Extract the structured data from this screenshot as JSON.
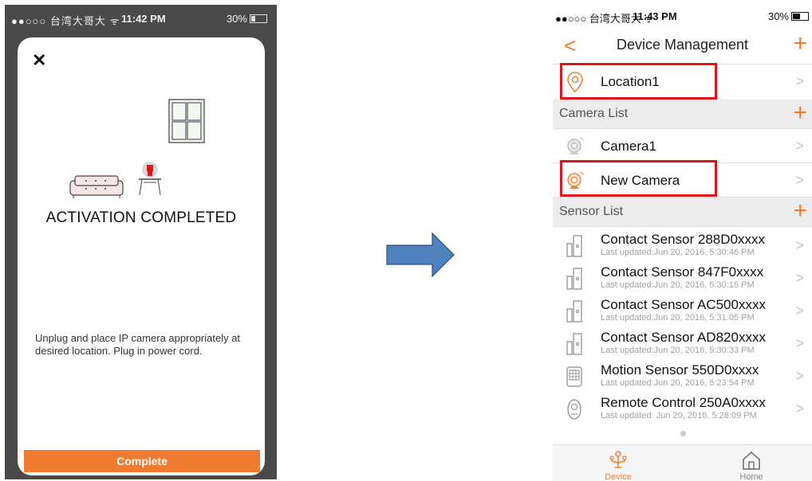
{
  "left_phone": {
    "status": {
      "signal": "●●○○○ 台湾大哥大 ᯤ",
      "time": "11:42 PM",
      "battery": "30%"
    },
    "close_icon": "✕",
    "title": "ACTIVATION COMPLETED",
    "description": "Unplug and place IP camera appropriately at desired location. Plug in power cord.",
    "complete_button": "Complete"
  },
  "right_phone": {
    "status": {
      "signal": "●●○○○ 台湾大哥大 ᯤ",
      "time": "11:43 PM",
      "battery": "30%"
    },
    "nav": {
      "back": "<",
      "title": "Device Management",
      "add": "+"
    },
    "location": {
      "label": "Location1",
      "icon": "location-pin-icon"
    },
    "camera_section": {
      "title": "Camera List",
      "add": "+"
    },
    "cameras": [
      {
        "label": "Camera1",
        "icon": "camera-icon-gray"
      },
      {
        "label": "New Camera",
        "icon": "camera-icon-orange"
      }
    ],
    "sensor_section": {
      "title": "Sensor List",
      "add": "+"
    },
    "sensors": [
      {
        "name": "Contact Sensor 288D0xxxx",
        "updated": "Last updated:Jun 20, 2016, 5:30:46 PM",
        "icon": "contact-sensor-icon"
      },
      {
        "name": "Contact Sensor 847F0xxxx",
        "updated": "Last updated:Jun 20, 2016, 5:30:15 PM",
        "icon": "contact-sensor-icon"
      },
      {
        "name": "Contact Sensor AC500xxxx",
        "updated": "Last updated:Jun 20, 2016, 5:31:05 PM",
        "icon": "contact-sensor-icon"
      },
      {
        "name": "Contact Sensor AD820xxxx",
        "updated": "Last updated:Jun 20, 2016, 5:30:33 PM",
        "icon": "contact-sensor-icon"
      },
      {
        "name": "Motion Sensor 550D0xxxx",
        "updated": "Last updated:Jun 20, 2016, 5:23:54 PM",
        "icon": "motion-sensor-icon"
      },
      {
        "name": "Remote Control 250A0xxxx",
        "updated": "Last updated: Jun 20, 2016, 5:28:09 PM",
        "icon": "remote-control-icon"
      }
    ],
    "chevron": ">",
    "tabs": [
      {
        "label": "Device",
        "icon": "device-tree-icon",
        "active": true
      },
      {
        "label": "Home",
        "icon": "home-icon",
        "active": false
      }
    ]
  },
  "colors": {
    "accent": "#ee7b2f",
    "highlight": "#e0151b",
    "arrow": "#4f81bd"
  }
}
